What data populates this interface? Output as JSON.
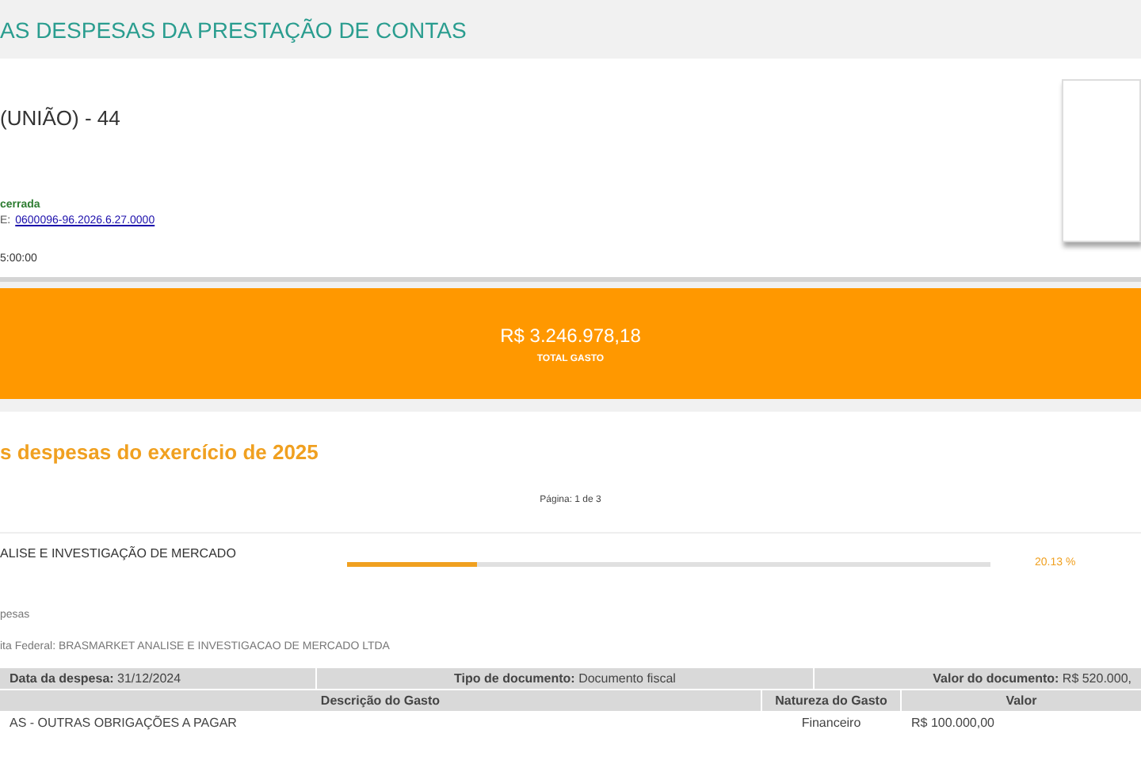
{
  "page_title": "AS DESPESAS DA PRESTAÇÃO DE CONTAS",
  "candidate": {
    "name": "(UNIÃO) - 44",
    "status": "cerrada",
    "process_label": "E:",
    "process_link": "0600096-96.2026.6.27.0000",
    "time": "5:00:00"
  },
  "total": {
    "value": "R$ 3.246.978,18",
    "label": "TOTAL GASTO"
  },
  "section_title": "s despesas do exercício de 2025",
  "pagination": "Página: 1 de 3",
  "expenses": [
    {
      "category": "ALISE E INVESTIGAÇÃO DE MERCADO",
      "level": 0.2013,
      "percent": "20.13 %",
      "count_label": "pesas",
      "supplier": "ita Federal: BRASMARKET ANALISE E INVESTIGACAO DE MERCADO LTDA",
      "summary": [
        {
          "label": "Data da despesa:",
          "value": "31/12/2024"
        },
        {
          "label": "Tipo de documento:",
          "value": "Documento fiscal"
        },
        {
          "label": "Valor do documento:",
          "value": "R$ 520.000,"
        }
      ],
      "columns": [
        "Descrição do Gasto",
        "Natureza do Gasto",
        "Valor"
      ],
      "rows": [
        [
          "AS - OUTRAS OBRIGAÇÕES A PAGAR",
          "Financeiro",
          "R$ 100.000,00"
        ]
      ]
    }
  ]
}
